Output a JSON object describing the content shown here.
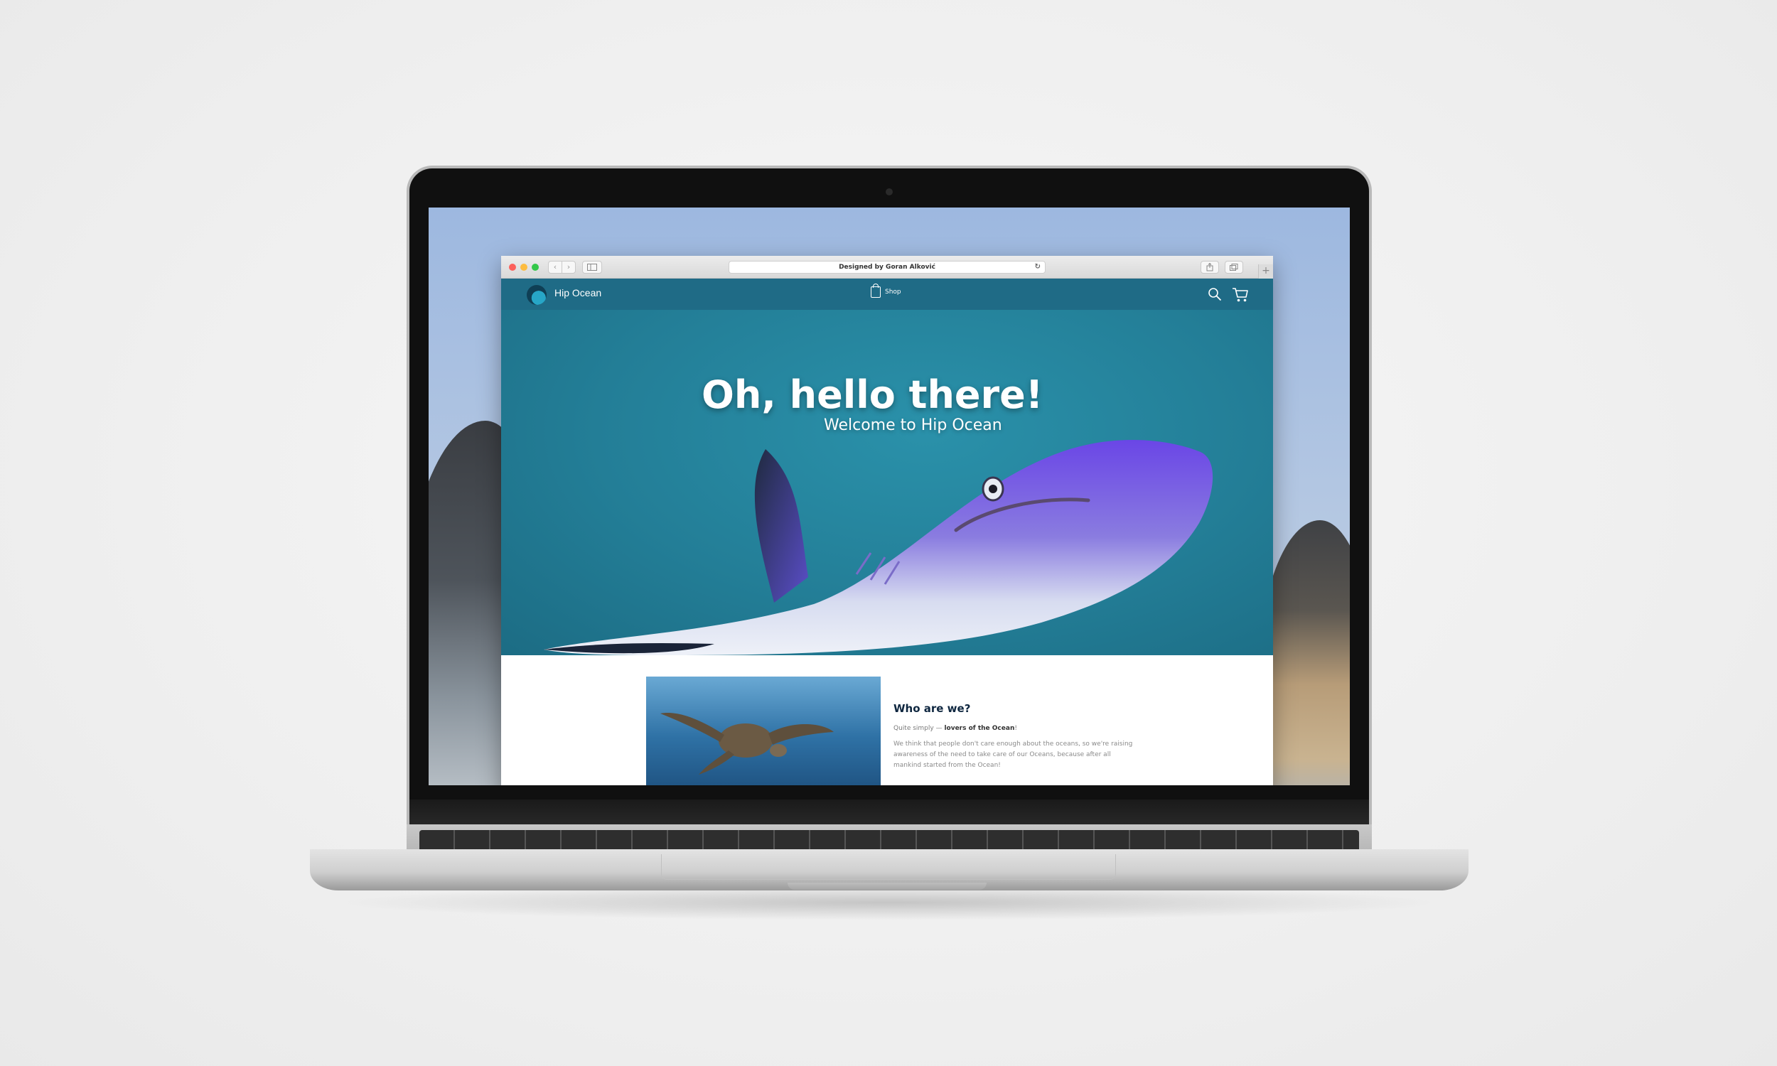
{
  "browser": {
    "address_text": "Designed by Goran Alković",
    "back_glyph": "‹",
    "forward_glyph": "›",
    "reload_glyph": "↻",
    "plus_glyph": "+"
  },
  "site": {
    "brand": "Hip Ocean",
    "nav_shop": "Shop",
    "hero_title": "Oh, hello there!",
    "hero_subtitle": "Welcome to Hip Ocean",
    "about": {
      "title": "Who are we?",
      "intro_prefix": "Quite simply — ",
      "intro_bold": "lovers of the Ocean",
      "intro_suffix": "!",
      "paragraph": "We think that people don't care enough about the oceans, so we're raising awareness of the need to take care of our Oceans, because after all mankind started from the Ocean!"
    }
  },
  "colors": {
    "header": "#1f6b86",
    "hero": "#237e97",
    "shark_accent": "#6b4fd8",
    "title_dark": "#0f2740"
  }
}
